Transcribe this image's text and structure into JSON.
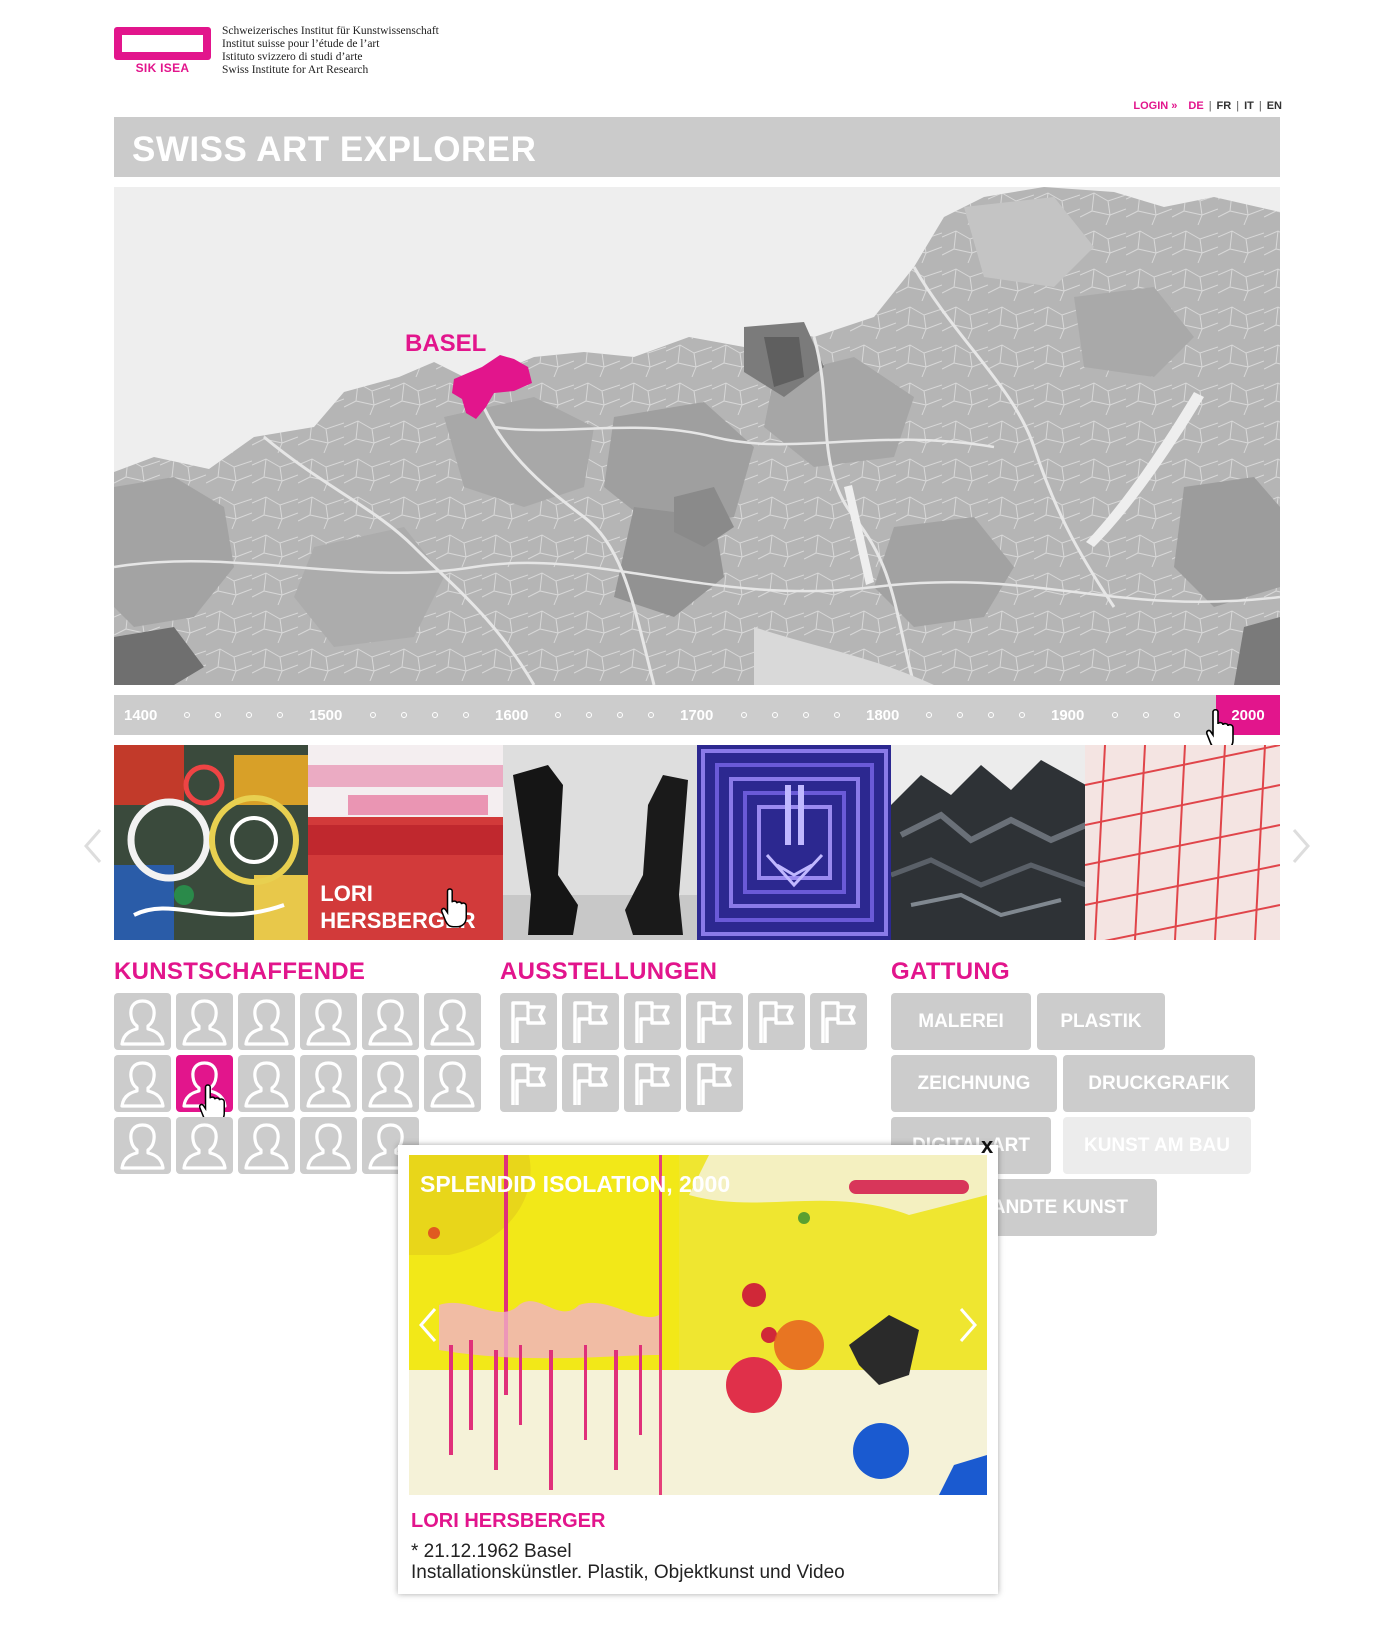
{
  "header": {
    "logo_text": "SIK ISEA",
    "institute_lines": [
      "Schweizerisches Institut für Kunstwissenschaft",
      "Institut suisse pour l’étude de l’art",
      "Istituto svizzero di studi d’arte",
      "Swiss Institute for Art Research"
    ]
  },
  "topnav": {
    "login": "LOGIN »",
    "languages": [
      "DE",
      "FR",
      "IT",
      "EN"
    ],
    "active_language": "DE",
    "separator": "|"
  },
  "title": "SWISS ART EXPLORER",
  "map": {
    "highlight_label": "BASEL"
  },
  "timeline": {
    "years": [
      "1400",
      "1500",
      "1600",
      "1700",
      "1800",
      "1900"
    ],
    "active_year": "2000"
  },
  "gallery": {
    "tiles": [
      {
        "label": ""
      },
      {
        "label": "LORI\nHERSBERGER"
      },
      {
        "label": ""
      },
      {
        "label": ""
      },
      {
        "label": ""
      },
      {
        "label": ""
      }
    ]
  },
  "sections": {
    "artists": {
      "title": "KUNSTSCHAFFENDE",
      "count": 17,
      "active_index": 7
    },
    "exhibitions": {
      "title": "AUSSTELLUNGEN",
      "count": 10
    },
    "genre": {
      "title": "GATTUNG",
      "buttons": [
        "MALEREI",
        "PLASTIK",
        "ZEICHNUNG",
        "DRUCKGRAFIK",
        "DIGITAL ART",
        "KUNST AM BAU",
        "ANGEWANDTE KUNST"
      ]
    }
  },
  "popup": {
    "close": "x",
    "title": "SPLENDID ISOLATION, 2000",
    "artist": "LORI HERSBERGER",
    "born": "* 21.12.1962 Basel",
    "description": "Installationskünstler. Plastik, Objektkunst und Video"
  },
  "colors": {
    "accent": "#e2158c",
    "panel": "#cccccc"
  }
}
